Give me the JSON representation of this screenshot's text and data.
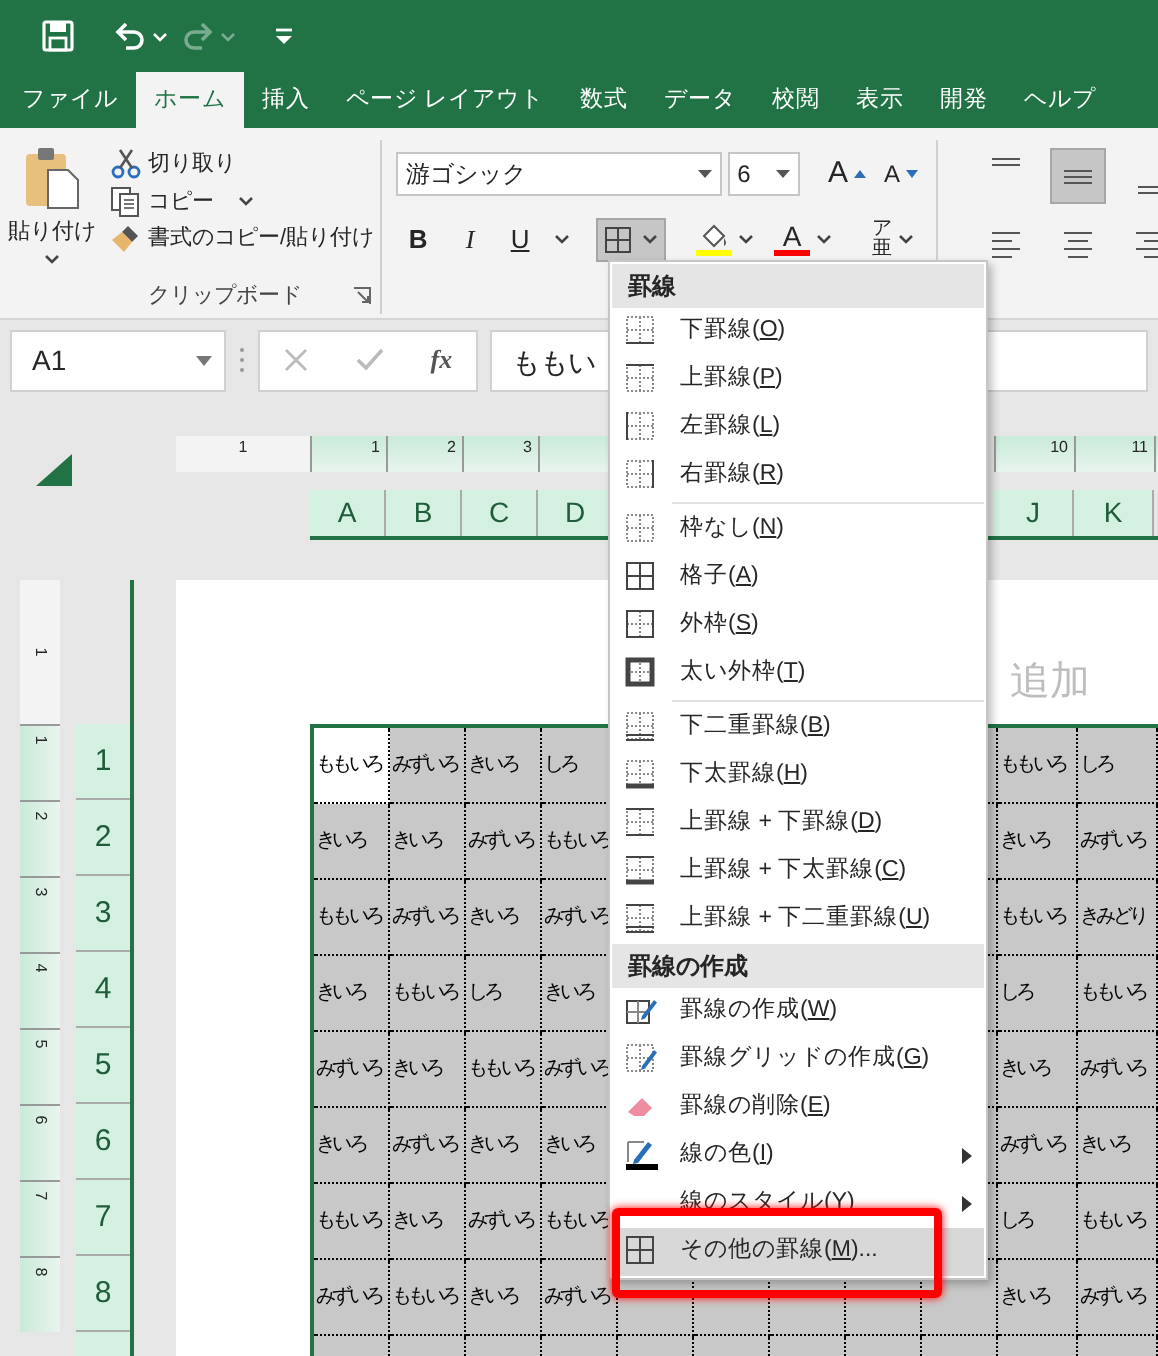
{
  "quick_access": [
    {
      "kind": "save",
      "disabled": false
    },
    {
      "kind": "undo",
      "disabled": false
    },
    {
      "kind": "redo",
      "disabled": true
    },
    {
      "kind": "customize",
      "disabled": false
    }
  ],
  "tabs": [
    {
      "label": "ファイル",
      "selected": false
    },
    {
      "label": "ホーム",
      "selected": true
    },
    {
      "label": "挿入",
      "selected": false
    },
    {
      "label": "ページ レイアウト",
      "selected": false
    },
    {
      "label": "数式",
      "selected": false
    },
    {
      "label": "データ",
      "selected": false
    },
    {
      "label": "校閲",
      "selected": false
    },
    {
      "label": "表示",
      "selected": false
    },
    {
      "label": "開発",
      "selected": false
    },
    {
      "label": "ヘルプ",
      "selected": false
    }
  ],
  "clipboard": {
    "paste": "貼り付け",
    "cut": "切り取り",
    "copy": "コピー",
    "format_painter": "書式のコピー/貼り付け",
    "group_label": "クリップボード"
  },
  "font": {
    "name": "游ゴシック",
    "size": "6",
    "grow": "A",
    "shrink": "A",
    "bold": "B",
    "italic": "I",
    "underline": "U",
    "borders_pressed": true,
    "font_color_letter": "A",
    "phonetic_top": "ア",
    "phonetic_bottom": "亜"
  },
  "alignment": {
    "vertical": [
      {
        "kind": "top",
        "selected": false
      },
      {
        "kind": "middle",
        "selected": true
      },
      {
        "kind": "bottom",
        "selected": false
      }
    ],
    "horizontal": [
      {
        "kind": "left",
        "selected": false
      },
      {
        "kind": "center",
        "selected": false
      },
      {
        "kind": "right",
        "selected": false
      }
    ]
  },
  "formula_bar": {
    "name_box": "A1",
    "function_label": "fx",
    "value": "ももい"
  },
  "top_ruler_margin_label": "1",
  "left_ruler_margin_label": "1",
  "columns_left": [
    {
      "letter": "A",
      "ruler": "1"
    },
    {
      "letter": "B",
      "ruler": "2"
    },
    {
      "letter": "C",
      "ruler": "3"
    },
    {
      "letter": "D"
    }
  ],
  "columns_right": [
    {
      "letter": "J",
      "ruler": "10"
    },
    {
      "letter": "K",
      "ruler": "11"
    }
  ],
  "page_header": "追加",
  "rows": [
    {
      "header": "1",
      "left": [
        {
          "text": "ももいろ",
          "selected": true
        },
        {
          "text": "みずいろ",
          "selected": false
        },
        {
          "text": "きいろ",
          "selected": false
        },
        {
          "text": "しろ",
          "selected": false
        }
      ],
      "right": [
        {
          "text": "ももいろ",
          "selected": false
        },
        {
          "text": "しろ",
          "selected": false
        }
      ]
    },
    {
      "header": "2",
      "left": [
        {
          "text": "きいろ",
          "selected": false
        },
        {
          "text": "きいろ",
          "selected": false
        },
        {
          "text": "みずいろ",
          "selected": false
        },
        {
          "text": "ももいろ",
          "selected": false
        }
      ],
      "right": [
        {
          "text": "きいろ",
          "selected": false
        },
        {
          "text": "みずいろ",
          "selected": false
        }
      ]
    },
    {
      "header": "3",
      "left": [
        {
          "text": "ももいろ",
          "selected": false
        },
        {
          "text": "みずいろ",
          "selected": false
        },
        {
          "text": "きいろ",
          "selected": false
        },
        {
          "text": "みずいろ",
          "selected": false
        }
      ],
      "right": [
        {
          "text": "ももいろ",
          "selected": false
        },
        {
          "text": "きみどり",
          "selected": false
        }
      ]
    },
    {
      "header": "4",
      "left": [
        {
          "text": "きいろ",
          "selected": false
        },
        {
          "text": "ももいろ",
          "selected": false
        },
        {
          "text": "しろ",
          "selected": false
        },
        {
          "text": "きいろ",
          "selected": false
        }
      ],
      "right": [
        {
          "text": "しろ",
          "selected": false
        },
        {
          "text": "ももいろ",
          "selected": false
        }
      ]
    },
    {
      "header": "5",
      "left": [
        {
          "text": "みずいろ",
          "selected": false
        },
        {
          "text": "きいろ",
          "selected": false
        },
        {
          "text": "ももいろ",
          "selected": false
        },
        {
          "text": "みずいろ",
          "selected": false
        }
      ],
      "right": [
        {
          "text": "きいろ",
          "selected": false
        },
        {
          "text": "みずいろ",
          "selected": false
        }
      ]
    },
    {
      "header": "6",
      "left": [
        {
          "text": "きいろ",
          "selected": false
        },
        {
          "text": "みずいろ",
          "selected": false
        },
        {
          "text": "きいろ",
          "selected": false
        },
        {
          "text": "きいろ",
          "selected": false
        }
      ],
      "right": [
        {
          "text": "みずいろ",
          "selected": false
        },
        {
          "text": "きいろ",
          "selected": false
        }
      ]
    },
    {
      "header": "7",
      "left": [
        {
          "text": "ももいろ",
          "selected": false
        },
        {
          "text": "きいろ",
          "selected": false
        },
        {
          "text": "みずいろ",
          "selected": false
        },
        {
          "text": "ももいろ",
          "selected": false
        }
      ],
      "right": [
        {
          "text": "しろ",
          "selected": false
        },
        {
          "text": "ももいろ",
          "selected": false
        }
      ]
    },
    {
      "header": "8",
      "left": [
        {
          "text": "みずいろ",
          "selected": false
        },
        {
          "text": "ももいろ",
          "selected": false
        },
        {
          "text": "きいろ",
          "selected": false
        },
        {
          "text": "みずいろ",
          "selected": false
        }
      ],
      "right": [
        {
          "text": "きいろ",
          "selected": false
        },
        {
          "text": "みずいろ",
          "selected": false
        }
      ]
    }
  ],
  "vertical_ruler": [
    "1",
    "2",
    "3",
    "4",
    "5",
    "6",
    "7",
    "8"
  ],
  "border_menu": [
    {
      "kind": "header",
      "label": "罫線"
    },
    {
      "kind": "bottom",
      "before": "下罫線(",
      "key": "O",
      "after": ")",
      "selected": false,
      "highlighted": false,
      "submenu": false
    },
    {
      "kind": "top",
      "before": "上罫線(",
      "key": "P",
      "after": ")",
      "selected": false,
      "highlighted": false,
      "submenu": false
    },
    {
      "kind": "left",
      "before": "左罫線(",
      "key": "L",
      "after": ")",
      "selected": false,
      "highlighted": false,
      "submenu": false
    },
    {
      "kind": "right",
      "before": "右罫線(",
      "key": "R",
      "after": ")",
      "selected": false,
      "highlighted": false,
      "submenu": false
    },
    {
      "kind": "separator"
    },
    {
      "kind": "none",
      "before": "枠なし(",
      "key": "N",
      "after": ")",
      "selected": false,
      "highlighted": false,
      "submenu": false
    },
    {
      "kind": "all",
      "before": "格子(",
      "key": "A",
      "after": ")",
      "selected": false,
      "highlighted": false,
      "submenu": false
    },
    {
      "kind": "outside",
      "before": "外枠(",
      "key": "S",
      "after": ")",
      "selected": false,
      "highlighted": false,
      "submenu": false
    },
    {
      "kind": "thick-outside",
      "before": "太い外枠(",
      "key": "T",
      "after": ")",
      "selected": false,
      "highlighted": false,
      "submenu": false
    },
    {
      "kind": "separator"
    },
    {
      "kind": "bottom-double",
      "before": "下二重罫線(",
      "key": "B",
      "after": ")",
      "selected": false,
      "highlighted": false,
      "submenu": false
    },
    {
      "kind": "thick-bottom",
      "before": "下太罫線(",
      "key": "H",
      "after": ")",
      "selected": false,
      "highlighted": false,
      "submenu": false
    },
    {
      "kind": "top-bottom",
      "before": "上罫線 + 下罫線(",
      "key": "D",
      "after": ")",
      "selected": false,
      "highlighted": false,
      "submenu": false
    },
    {
      "kind": "top-thick-bottom",
      "before": "上罫線 + 下太罫線(",
      "key": "C",
      "after": ")",
      "selected": false,
      "highlighted": false,
      "submenu": false
    },
    {
      "kind": "top-double-bottom",
      "before": "上罫線 + 下二重罫線(",
      "key": "U",
      "after": ")",
      "selected": false,
      "highlighted": false,
      "submenu": false
    },
    {
      "kind": "header",
      "label": "罫線の作成"
    },
    {
      "kind": "draw",
      "before": "罫線の作成(",
      "key": "W",
      "after": ")",
      "selected": false,
      "highlighted": false,
      "submenu": false
    },
    {
      "kind": "draw-grid",
      "before": "罫線グリッドの作成(",
      "key": "G",
      "after": ")",
      "selected": false,
      "highlighted": false,
      "submenu": false
    },
    {
      "kind": "erase",
      "before": "罫線の削除(",
      "key": "E",
      "after": ")",
      "selected": false,
      "highlighted": false,
      "submenu": false
    },
    {
      "kind": "line-color",
      "before": "線の色(",
      "key": "I",
      "after": ")",
      "selected": false,
      "highlighted": false,
      "submenu": true
    },
    {
      "kind": "plain",
      "before": "線のスタイル(",
      "key": "Y",
      "after": ")",
      "selected": false,
      "highlighted": false,
      "submenu": true
    },
    {
      "kind": "all",
      "before": "その他の罫線(",
      "key": "M",
      "after": ")...",
      "selected": true,
      "highlighted": true,
      "submenu": false
    }
  ]
}
